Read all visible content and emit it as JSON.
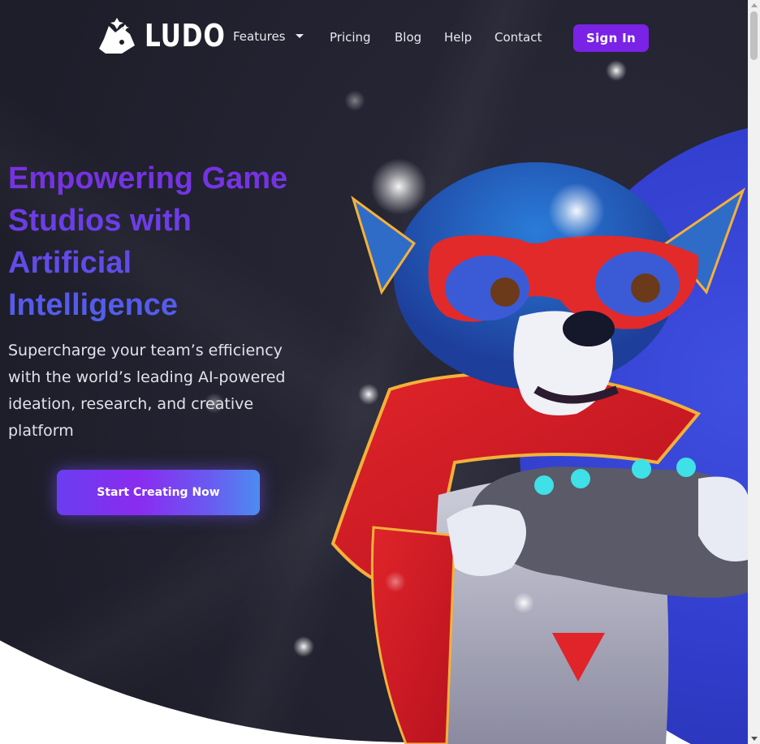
{
  "nav": {
    "logo_text": "LUDO",
    "logo_icon": "dog-logo-icon",
    "links": {
      "features": "Features",
      "pricing": "Pricing",
      "blog": "Blog",
      "help": "Help",
      "contact": "Contact"
    },
    "signin_label": "Sign In"
  },
  "hero": {
    "headline": "Empowering Game Studios with Artificial Intelligence",
    "subtext": "Supercharge your team’s efficiency with the world’s leading AI-powered ideation, research, and creative platform",
    "cta_label": "Start Creating Now"
  },
  "colors": {
    "background_dark": "#1e1e2b",
    "accent_purple": "#7a22e6",
    "accent_blue": "#3f4fe0",
    "headline_gradient_start": "#7a2ee0",
    "headline_gradient_end": "#4f63ea"
  }
}
